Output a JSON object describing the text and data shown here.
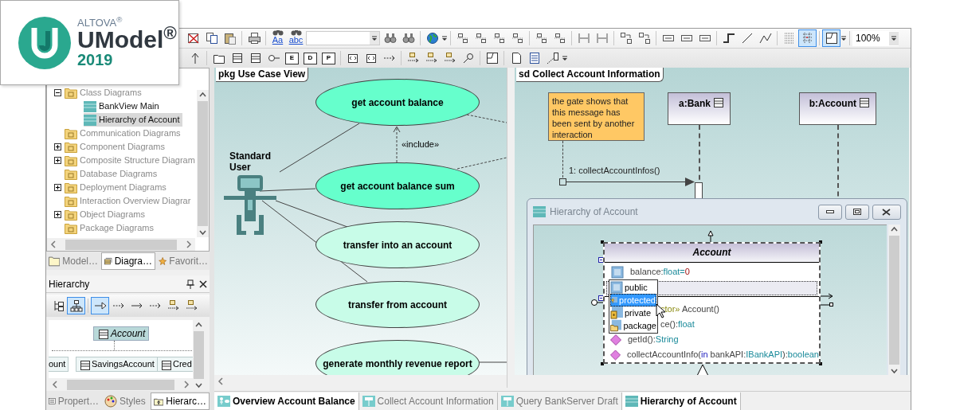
{
  "logo": {
    "company": "ALTOVA$^{®}$",
    "product": "UModel$^{®}$",
    "year": "2019"
  },
  "toolbar": {
    "find_labels": [
      "Aa",
      "abc"
    ],
    "element_letters": [
      "E",
      "D",
      "P"
    ],
    "layout_toggles": [
      {
        "pressed": false
      },
      {
        "pressed": true
      },
      {
        "pressed": true
      }
    ],
    "zoom": "100%"
  },
  "model_tree": {
    "items": [
      {
        "label": "Class Diagrams",
        "kind": "folder",
        "expandable": true,
        "expanded": true,
        "selected": false,
        "children": [
          {
            "label": "BankView Main",
            "kind": "diagram",
            "expandable": false,
            "selected": false
          },
          {
            "label": "Hierarchy of Account",
            "kind": "diagram",
            "expandable": false,
            "selected": true
          }
        ]
      },
      {
        "label": "Communication Diagrams",
        "kind": "folder",
        "expandable": false,
        "selected": false
      },
      {
        "label": "Component Diagrams",
        "kind": "folder",
        "expandable": true,
        "expanded": false,
        "selected": false
      },
      {
        "label": "Composite Structure Diagram",
        "kind": "folder",
        "expandable": true,
        "expanded": false,
        "selected": false
      },
      {
        "label": "Database Diagrams",
        "kind": "folder",
        "expandable": false,
        "selected": false
      },
      {
        "label": "Deployment Diagrams",
        "kind": "folder",
        "expandable": true,
        "expanded": false,
        "selected": false
      },
      {
        "label": "Interaction Overview Diagrar",
        "kind": "folder",
        "expandable": false,
        "selected": false
      },
      {
        "label": "Object Diagrams",
        "kind": "folder",
        "expandable": true,
        "expanded": false,
        "selected": false
      },
      {
        "label": "Package Diagrams",
        "kind": "folder",
        "expandable": false,
        "selected": false
      }
    ]
  },
  "panel_tabs": [
    {
      "label": "Model…",
      "selected": false
    },
    {
      "label": "Diagra…",
      "selected": true
    },
    {
      "label": "Favorit…",
      "selected": false
    }
  ],
  "hierarchy_panel": {
    "title": "Hierarchy",
    "toolbar": [
      {
        "pressed": false
      },
      {
        "pressed": true
      },
      {
        "pressed": true
      },
      {
        "pressed": false
      },
      {
        "pressed": false
      },
      {
        "pressed": false
      },
      {
        "pressed": false
      },
      {
        "pressed": false
      }
    ],
    "base_class": "Account",
    "subclasses": [
      "ount",
      "SavingsAccount",
      "Cred"
    ]
  },
  "bottom_tabs": [
    {
      "label": "Propert…",
      "selected": false
    },
    {
      "label": "Styles",
      "selected": false
    },
    {
      "label": "Hierarc…",
      "selected": true
    }
  ],
  "use_case_diagram": {
    "frame_label": "pkg Use Case View",
    "actor": "Standard User",
    "include_label": "«include»",
    "use_cases": [
      {
        "label": "get account balance",
        "color": "#66ffcc"
      },
      {
        "label": "get account balance sum",
        "color": "#66ffcc"
      },
      {
        "label": "transfer into an account",
        "color": "#c8fce8"
      },
      {
        "label": "transfer from account",
        "color": "#c8fce8"
      },
      {
        "label": "generate monthly revenue report",
        "color": "#c8fce8"
      }
    ]
  },
  "sequence_diagram": {
    "frame_label": "sd Collect Account Information",
    "note": "the gate shows that this message has been sent by another interaction",
    "lifelines": [
      "a:Bank",
      "b:Account"
    ],
    "message": "1: collectAccountInfos()"
  },
  "class_window": {
    "title": "Hierarchy of Account",
    "class_name": "Account",
    "attributes": [
      {
        "selected": false,
        "segments": [
          {
            "text": "balance:",
            "kind": "name"
          },
          {
            "text": "float=",
            "kind": "type"
          },
          {
            "text": "0",
            "kind": "value"
          }
        ]
      },
      {
        "selected": true
      }
    ],
    "visibility_menu": [
      {
        "label": "public",
        "selected": false
      },
      {
        "label": "protected",
        "selected": true
      },
      {
        "label": "private",
        "selected": false
      },
      {
        "label": "package",
        "selected": false
      }
    ],
    "operations": [
      {
        "partial": true,
        "segments": [
          {
            "text": "ctor»",
            "kind": "stereotype"
          },
          {
            "text": " Account()",
            "kind": "name"
          }
        ]
      },
      {
        "partial": true,
        "segments": [
          {
            "text": "ce():",
            "kind": "name"
          },
          {
            "text": "float",
            "kind": "type"
          }
        ]
      },
      {
        "partial": false,
        "segments": [
          {
            "text": "getId():",
            "kind": "name"
          },
          {
            "text": "String",
            "kind": "type"
          }
        ]
      },
      {
        "partial": false,
        "segments": [
          {
            "text": "collectAccountInfo(",
            "kind": "name"
          },
          {
            "text": "in",
            "kind": "keyword"
          },
          {
            "text": " bankAPI:",
            "kind": "name"
          },
          {
            "text": "IBankAPI",
            "kind": "type"
          },
          {
            "text": "):",
            "kind": "name"
          },
          {
            "text": "boolean",
            "kind": "type"
          }
        ]
      }
    ]
  },
  "doc_tabs": [
    {
      "label": "Overview Account Balance",
      "selected": true
    },
    {
      "label": "Collect Account Information",
      "selected": false
    },
    {
      "label": "Query BankServer Draft",
      "selected": false
    },
    {
      "label": "Hierarchy of Account",
      "selected": true
    }
  ]
}
